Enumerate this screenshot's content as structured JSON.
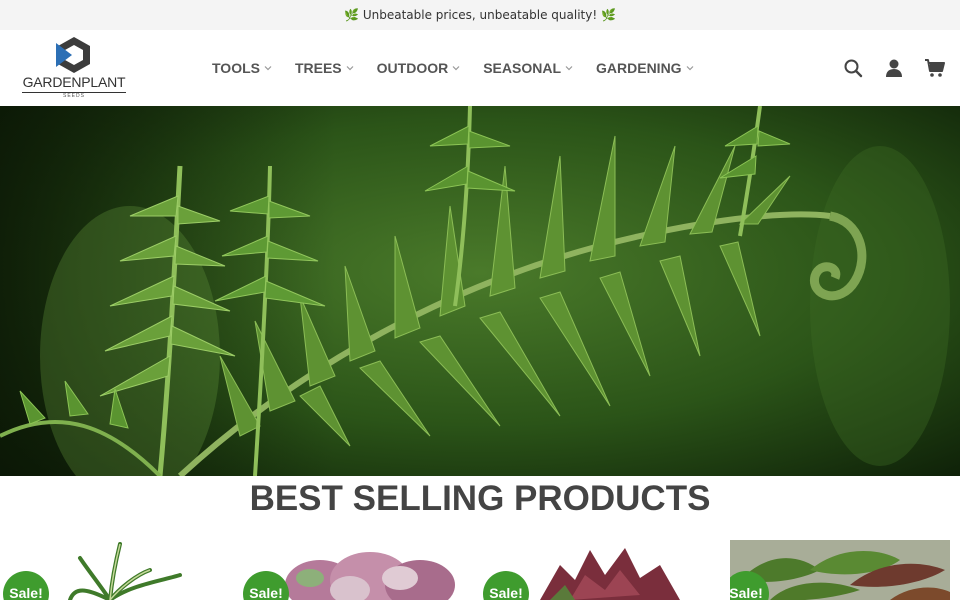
{
  "topbar": {
    "text": "🌿 Unbeatable prices, unbeatable quality! 🌿"
  },
  "header": {
    "logo": {
      "name": "GARDENPLANT",
      "tagline": "SEEDS",
      "brand_color": "#3c3c3c",
      "accent_color": "#2c6fb5"
    },
    "nav": [
      {
        "label": "TOOLS",
        "icon": "chevron-down-icon"
      },
      {
        "label": "TREES",
        "icon": "chevron-down-icon"
      },
      {
        "label": "OUTDOOR",
        "icon": "chevron-down-icon"
      },
      {
        "label": "SEASONAL",
        "icon": "chevron-down-icon"
      },
      {
        "label": "GARDENING",
        "icon": "chevron-down-icon"
      }
    ],
    "icons": [
      "search-icon",
      "user-icon",
      "cart-icon"
    ]
  },
  "hero": {
    "image": "fern-fronds-photo"
  },
  "best_selling": {
    "title": "BEST SELLING PRODUCTS",
    "products": [
      {
        "badge": "Sale!",
        "image": "spider-plant-photo"
      },
      {
        "badge": "Sale!",
        "image": "pink-leaf-plant-photo"
      },
      {
        "badge": "Sale!",
        "image": "purple-leaf-plant-photo"
      },
      {
        "badge": "Sale!",
        "image": "croton-plant-photo"
      }
    ],
    "badge_color": "#3f9c2e"
  }
}
